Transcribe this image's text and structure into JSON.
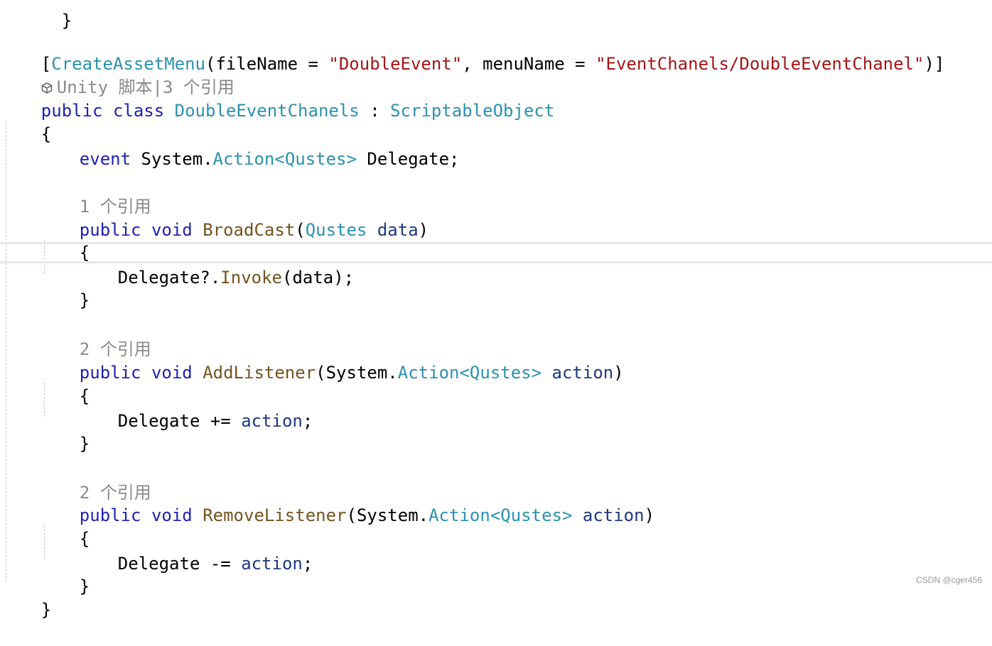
{
  "editor": {
    "line_top": "  }",
    "attribute": {
      "open": "[",
      "name": "CreateAssetMenu",
      "p1": "(fileName = ",
      "v1": "\"DoubleEvent\"",
      "p2": ", menuName = ",
      "v2": "\"EventChanels/DoubleEventChanel\"",
      "close": ")]"
    },
    "lens_class": "Unity 脚本|3 个引用",
    "class_decl": {
      "kw1": "public",
      "kw2": "class",
      "name": "DoubleEventChanels",
      "sep": " : ",
      "base": "ScriptableObject"
    },
    "brace_open": "{",
    "event_decl": {
      "kw": "event",
      "ns": "System.",
      "type1": "Action",
      "lt": "<",
      "type2": "Qustes",
      "gt": ">",
      "rest": " Delegate;"
    },
    "methods": [
      {
        "lens": "1 个引用",
        "kw1": "public",
        "kw2": "void",
        "name": "BroadCast",
        "params": {
          "open": "(",
          "ns": "",
          "type1": "Qustes",
          "type2": "",
          "pname": "data",
          "close": ")"
        },
        "body": "Delegate?.",
        "call": "Invoke",
        "call_args": "(data);"
      },
      {
        "lens": "2 个引用",
        "kw1": "public",
        "kw2": "void",
        "name": "AddListener",
        "params": {
          "open": "(",
          "ns": "System.",
          "type1": "Action",
          "type2": "Qustes",
          "pname": "action",
          "close": ")"
        },
        "body": "Delegate += ",
        "body_ident": "action",
        "body_end": ";"
      },
      {
        "lens": "2 个引用",
        "kw1": "public",
        "kw2": "void",
        "name": "RemoveListener",
        "params": {
          "open": "(",
          "ns": "System.",
          "type1": "Action",
          "type2": "Qustes",
          "pname": "action",
          "close": ")"
        },
        "body": "Delegate -= ",
        "body_ident": "action",
        "body_end": ";"
      }
    ],
    "brace": "{",
    "brace_close": "}"
  },
  "watermark": "CSDN @cger456",
  "colors": {
    "keyword": "#1f1fb4",
    "type": "#2b91af",
    "method": "#74531f",
    "string": "#a31515",
    "codelens": "#8a8a8a"
  }
}
